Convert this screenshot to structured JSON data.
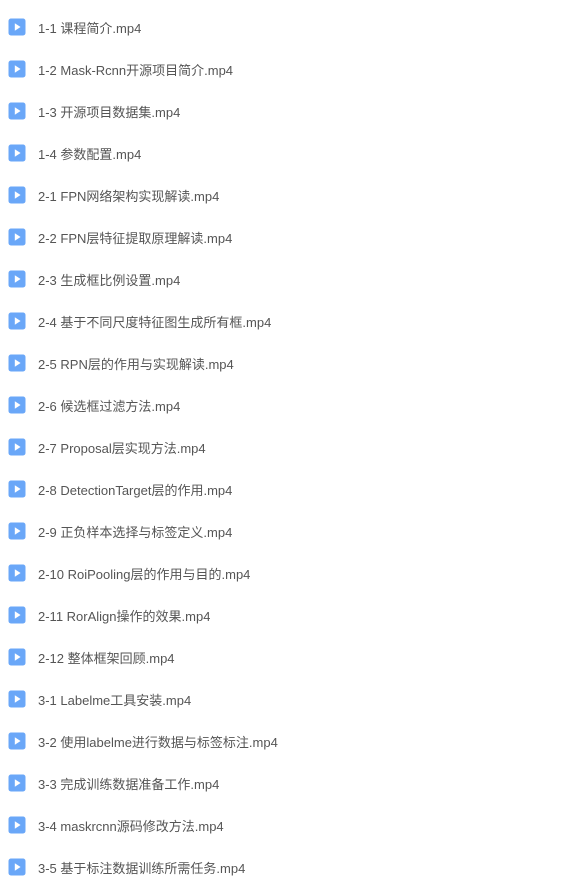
{
  "files": [
    {
      "name": "1-1 课程简介.mp4"
    },
    {
      "name": "1-2 Mask-Rcnn开源项目简介.mp4"
    },
    {
      "name": "1-3 开源项目数据集.mp4"
    },
    {
      "name": "1-4 参数配置.mp4"
    },
    {
      "name": "2-1 FPN网络架构实现解读.mp4"
    },
    {
      "name": "2-2 FPN层特征提取原理解读.mp4"
    },
    {
      "name": "2-3 生成框比例设置.mp4"
    },
    {
      "name": "2-4 基于不同尺度特征图生成所有框.mp4"
    },
    {
      "name": "2-5 RPN层的作用与实现解读.mp4"
    },
    {
      "name": "2-6 候选框过滤方法.mp4"
    },
    {
      "name": "2-7 Proposal层实现方法.mp4"
    },
    {
      "name": "2-8 DetectionTarget层的作用.mp4"
    },
    {
      "name": "2-9 正负样本选择与标签定义.mp4"
    },
    {
      "name": "2-10 RoiPooling层的作用与目的.mp4"
    },
    {
      "name": "2-11 RorAlign操作的效果.mp4"
    },
    {
      "name": "2-12 整体框架回顾.mp4"
    },
    {
      "name": "3-1 Labelme工具安装.mp4"
    },
    {
      "name": "3-2 使用labelme进行数据与标签标注.mp4"
    },
    {
      "name": "3-3 完成训练数据准备工作.mp4"
    },
    {
      "name": "3-4 maskrcnn源码修改方法.mp4"
    },
    {
      "name": "3-5 基于标注数据训练所需任务.mp4"
    }
  ],
  "icon_color": "#6aa7f8"
}
